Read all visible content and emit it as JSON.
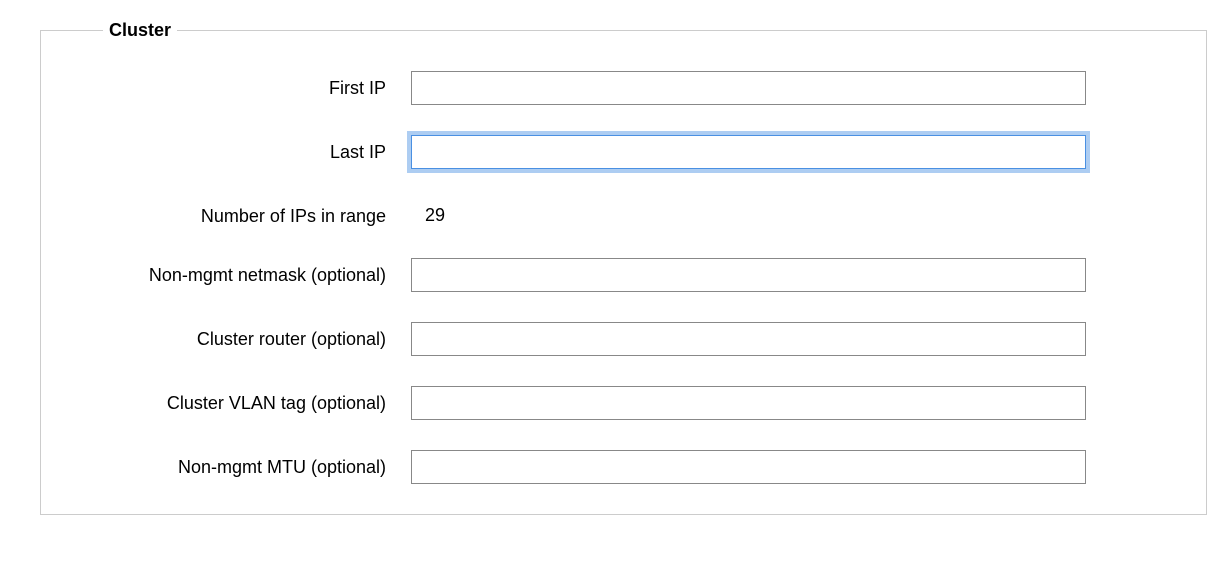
{
  "cluster": {
    "legend": "Cluster",
    "first_ip": {
      "label": "First IP",
      "value": ""
    },
    "last_ip": {
      "label": "Last IP",
      "value": ""
    },
    "num_ips": {
      "label": "Number of IPs in range",
      "value": "29"
    },
    "non_mgmt_netmask": {
      "label": "Non-mgmt netmask (optional)",
      "value": ""
    },
    "cluster_router": {
      "label": "Cluster router (optional)",
      "value": ""
    },
    "cluster_vlan_tag": {
      "label": "Cluster VLAN tag (optional)",
      "value": ""
    },
    "non_mgmt_mtu": {
      "label": "Non-mgmt MTU (optional)",
      "value": ""
    }
  }
}
